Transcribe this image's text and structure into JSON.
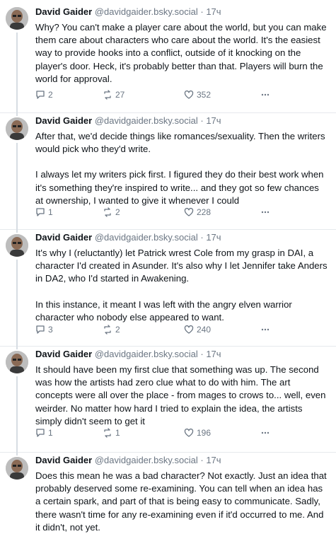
{
  "posts": [
    {
      "author": "David Gaider",
      "handle": "@davidgaider.bsky.social",
      "time": "17ч",
      "paragraphs": [
        "Why? You can't make a player care about the world, but you can make them care about characters who care about the world. It's the easiest way to provide hooks into a conflict, outside of it knocking on the player's door. Heck, it's probably better than that. Players will burn the world for approval."
      ],
      "replies": "2",
      "reposts": "27",
      "likes": "352"
    },
    {
      "author": "David Gaider",
      "handle": "@davidgaider.bsky.social",
      "time": "17ч",
      "paragraphs": [
        "After that, we'd decide things like romances/sexuality. Then the writers would pick who they'd write.",
        "I always let my writers pick first. I figured they do their best work when it's something they're inspired to write... and they got so few chances at ownership, I wanted to give it whenever I could"
      ],
      "replies": "1",
      "reposts": "2",
      "likes": "228"
    },
    {
      "author": "David Gaider",
      "handle": "@davidgaider.bsky.social",
      "time": "17ч",
      "paragraphs": [
        "It's why I (reluctantly) let Patrick wrest Cole from my grasp in DAI, a character I'd created in Asunder. It's also why I let Jennifer take Anders in DA2, who I'd started in Awakening.",
        "In this instance, it meant I was left with the angry elven warrior character who nobody else appeared to want."
      ],
      "replies": "3",
      "reposts": "2",
      "likes": "240"
    },
    {
      "author": "David Gaider",
      "handle": "@davidgaider.bsky.social",
      "time": "17ч",
      "paragraphs": [
        "It should have been my first clue that something was up. The second was how the artists had zero clue what to do with him. The art concepts were all over the place - from mages to crows to... well, even weirder. No matter how hard I tried to explain the idea, the artists simply didn't seem to get it"
      ],
      "replies": "1",
      "reposts": "1",
      "likes": "196"
    },
    {
      "author": "David Gaider",
      "handle": "@davidgaider.bsky.social",
      "time": "17ч",
      "paragraphs": [
        "Does this mean he was a bad character? Not exactly. Just an idea that probably deserved some re-examining. You can tell when an idea has a certain spark, and part of that is being easy to communicate. Sadly, there wasn't time for any re-examining even if it'd occurred to me. And it didn't, not yet."
      ]
    }
  ],
  "icons": {
    "reply": "reply-bubble-icon",
    "repost": "repost-arrows-icon",
    "like": "heart-icon",
    "more": "more-dots-icon"
  },
  "colors": {
    "meta": "#6b7683",
    "text": "#0f1419",
    "divider": "#e6e9ed"
  }
}
